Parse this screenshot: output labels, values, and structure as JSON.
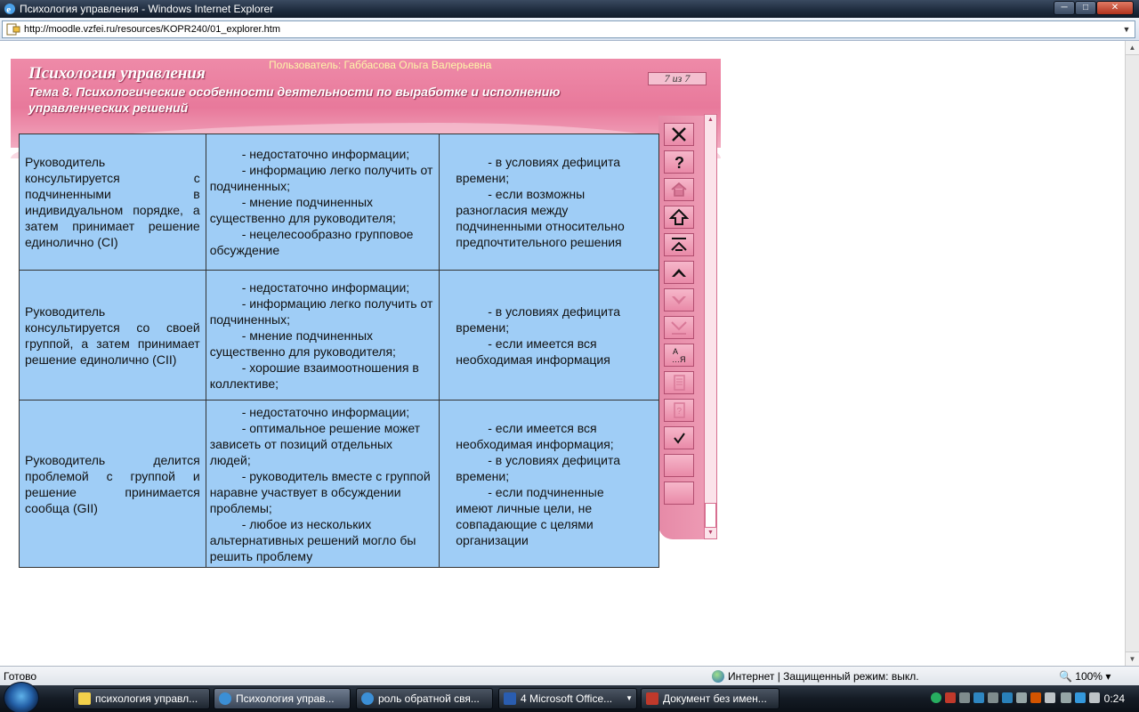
{
  "window": {
    "title": "Психология управления - Windows Internet Explorer"
  },
  "address": {
    "url": "http://moodle.vzfei.ru/resources/KOPR240/01_explorer.htm"
  },
  "course": {
    "title": "Психология управления",
    "user": "Пользователь: Габбасова Ольга Валерьевна",
    "topic": "Тема 8.  Психологические особенности деятельности по выработке и исполнению управленческих решений",
    "page_counter": "7 из 7"
  },
  "table": {
    "rows": [
      {
        "c1": "Руководитель консультируется с подчиненными в индивидуальном порядке, а затем принимает решение единолично (CI)",
        "c2": [
          "- недостаточно информации;",
          "- информацию легко получить от  подчиненных;",
          "- мнение подчиненных существенно для руководителя;",
          "- нецелесообразно групповое обсуждение"
        ],
        "c3": [
          "- в условиях дефицита времени;",
          "- если возможны разногласия между подчиненными относительно предпочтительного решения"
        ]
      },
      {
        "c1": "Руководитель консультируется со своей группой, а затем принимает решение единолично (CII)",
        "c2": [
          "- недостаточно информации;",
          "- информацию легко получить от  подчиненных;",
          "- мнение подчиненных существенно для руководителя;",
          "- хорошие взаимоотношения в коллективе;"
        ],
        "c3": [
          "- в условиях дефицита времени;",
          "- если имеется вся необходимая информация"
        ]
      },
      {
        "c1": "Руководитель делится проблемой с группой и решение принимается сообща (GII)",
        "c2": [
          "- недостаточно информации;",
          "- оптимальное решение может зависеть от позиций отдельных людей;",
          "- руководитель вместе с группой наравне участвует в обсуждении проблемы;",
          "- любое из нескольких альтернативных решений могло бы решить проблему"
        ],
        "c3": [
          "- если имеется вся необходимая информация;",
          "- в условиях дефицита времени;",
          "- если подчиненные имеют личные цели, не совпадающие с целями организации"
        ]
      }
    ]
  },
  "nav_buttons": [
    {
      "name": "close-icon",
      "enabled": true
    },
    {
      "name": "help-icon",
      "enabled": true
    },
    {
      "name": "home-icon",
      "enabled": false
    },
    {
      "name": "arrow-up-icon",
      "enabled": true
    },
    {
      "name": "to-top-icon",
      "enabled": true
    },
    {
      "name": "chevron-up-icon",
      "enabled": true
    },
    {
      "name": "chevron-down-icon",
      "enabled": false
    },
    {
      "name": "to-bottom-icon",
      "enabled": false
    },
    {
      "name": "glossary-icon",
      "enabled": true,
      "label": "А\n…Я"
    },
    {
      "name": "document-icon",
      "enabled": false
    },
    {
      "name": "quiz-icon",
      "enabled": false
    },
    {
      "name": "check-icon",
      "enabled": true
    },
    {
      "name": "blank-button-1",
      "enabled": false
    },
    {
      "name": "blank-button-2",
      "enabled": false
    }
  ],
  "status": {
    "left": "Готово",
    "zone": "Интернет | Защищенный режим: выкл.",
    "zoom": "100%"
  },
  "taskbar": {
    "items": [
      {
        "label": "психология управл...",
        "icon_color": "#f2d04b",
        "active": false
      },
      {
        "label": "Психология управ...",
        "icon_color": "#3b8fd6",
        "active": true
      },
      {
        "label": "роль обратной свя...",
        "icon_color": "#3b8fd6",
        "active": false
      },
      {
        "label": "4 Microsoft Office...",
        "icon_color": "#2a5db0",
        "active": false
      },
      {
        "label": "Документ без имен...",
        "icon_color": "#c0392b",
        "active": false
      }
    ],
    "clock": "0:24"
  },
  "colors": {
    "pink_frame": "#e8799b",
    "table_cell": "#9fcdf6",
    "user_text": "#fdf6a8"
  }
}
